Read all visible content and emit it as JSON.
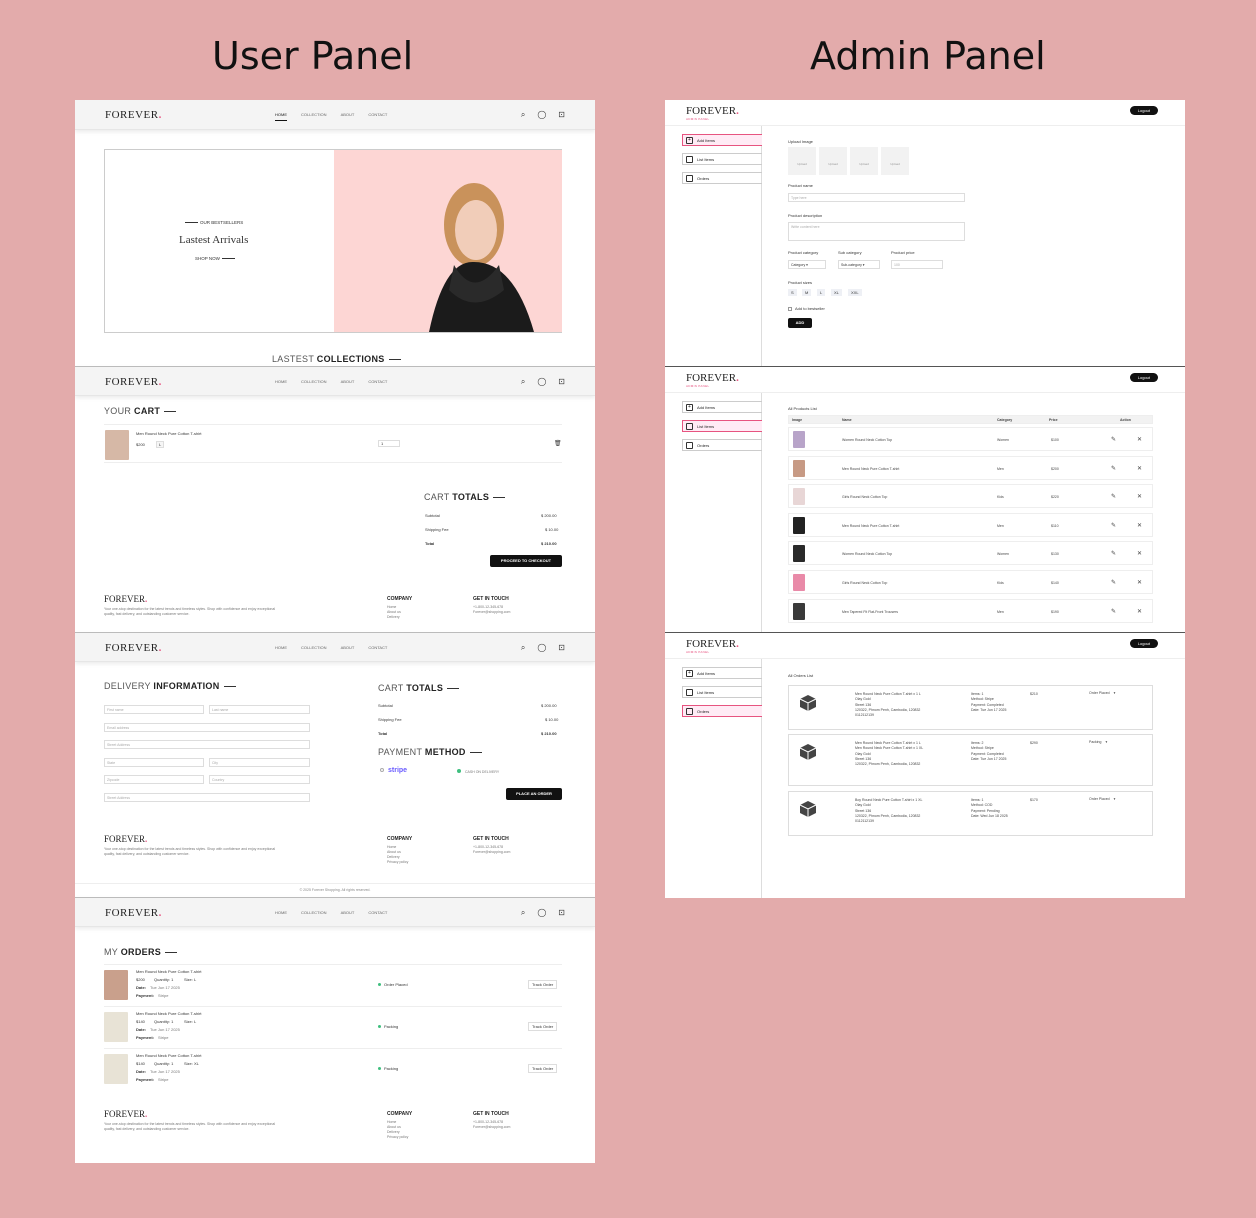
{
  "headings": {
    "user": "User Panel",
    "admin": "Admin Panel"
  },
  "brand": {
    "name": "FOREVER",
    "dot": ".",
    "admin_sub": "ADMIN PANEL",
    "accent": "#e75480"
  },
  "nav": {
    "links": [
      "HOME",
      "COLLECTION",
      "ABOUT",
      "CONTACT"
    ],
    "icons": [
      "search-icon",
      "user-icon",
      "cart-icon"
    ]
  },
  "hero": {
    "kicker": "OUR BESTSELLERS",
    "title": "Lastest Arrivals",
    "cta": "SHOP NOW",
    "collections_a": "LASTEST",
    "collections_b": "COLLECTIONS"
  },
  "cart": {
    "title_a": "YOUR",
    "title_b": "CART",
    "item": "Men Round Neck Pure Cotton T-shirt",
    "price": "$200",
    "size": "L",
    "qty": "1",
    "totals_a": "CART",
    "totals_b": "TOTALS",
    "subtotal_label": "Subtotal",
    "subtotal": "$ 200.00",
    "shipping_label": "Shipping Fee",
    "shipping": "$ 10.00",
    "total_label": "Total",
    "total": "$ 210.00",
    "checkout": "PROCEED TO CHECKOUT"
  },
  "footer": {
    "desc": "Your one-stop destination for the latest trends and timeless styles. Shop with confidence and enjoy exceptional quality, fast delivery, and outstanding customer service.",
    "company": "COMPANY",
    "company_links": [
      "Home",
      "About us",
      "Delivery",
      "Privacy policy"
    ],
    "contact": "GET IN TOUCH",
    "phone": "+1-800-12-345-678",
    "email": "Forever@shopping.com",
    "copyright": "© 2025 Forever Shopping. All rights reserved."
  },
  "delivery": {
    "title_a": "DELIVERY",
    "title_b": "INFORMATION",
    "first": "First name",
    "last": "Last name",
    "email": "Email address",
    "street": "Street Address",
    "state": "State",
    "city": "City",
    "zip": "Zipcode",
    "country": "Country",
    "phone": "Street Address",
    "payment_a": "PAYMENT",
    "payment_b": "METHOD",
    "stripe": "stripe",
    "cod": "CASH ON DELIVERY",
    "place": "PLACE AN ORDER"
  },
  "orders": {
    "title_a": "MY",
    "title_b": "ORDERS",
    "track": "Track Order",
    "items": [
      {
        "name": "Men Round Neck Pure Cotton T-shirt",
        "price": "$200",
        "qty": "Quantity: 1",
        "size": "Size: L",
        "date": "Date:",
        "date_v": "Tue Jun 17 2025",
        "pay": "Payment:",
        "pay_v": "Stripe",
        "status": "Order Placed"
      },
      {
        "name": "Men Round Neck Pure Cotton T-shirt",
        "price": "$140",
        "qty": "Quantity: 1",
        "size": "Size: L",
        "date": "Date:",
        "date_v": "Tue Jun 17 2025",
        "pay": "Payment:",
        "pay_v": "Stripe",
        "status": "Packing"
      },
      {
        "name": "Men Round Neck Pure Cotton T-shirt",
        "price": "$140",
        "qty": "Quantity: 1",
        "size": "Size: XL",
        "date": "Date:",
        "date_v": "Tue Jun 17 2025",
        "pay": "Payment:",
        "pay_v": "Stripe",
        "status": "Packing"
      }
    ]
  },
  "admin": {
    "logout": "Logout",
    "sidebar": [
      "Add Items",
      "List Items",
      "Orders"
    ],
    "add": {
      "upload": "Upload Image",
      "upload_box": "Upload",
      "name_label": "Product name",
      "name_ph": "Type here",
      "desc_label": "Product description",
      "desc_ph": "Write content here",
      "cat_label": "Product category",
      "cat": "Category",
      "sub_label": "Sub category",
      "sub": "Sub-category",
      "price_label": "Product price",
      "price_ph": "100",
      "sizes_label": "Product sizes",
      "sizes": [
        "S",
        "M",
        "L",
        "XL",
        "XXL"
      ],
      "best": "Add to bestseller",
      "add_btn": "ADD"
    },
    "list": {
      "title": "All Products List",
      "cols": [
        "Image",
        "Name",
        "Category",
        "Price",
        "Action"
      ],
      "rows": [
        {
          "name": "Women Round Neck Cotton Top",
          "cat": "Women",
          "price": "$100"
        },
        {
          "name": "Men Round Neck Pure Cotton T-shirt",
          "cat": "Men",
          "price": "$200"
        },
        {
          "name": "Girls Round Neck Cotton Top",
          "cat": "Kids",
          "price": "$220"
        },
        {
          "name": "Men Round Neck Pure Cotton T-shirt",
          "cat": "Men",
          "price": "$110"
        },
        {
          "name": "Women Round Neck Cotton Top",
          "cat": "Women",
          "price": "$130"
        },
        {
          "name": "Girls Round Neck Cotton Top",
          "cat": "Kids",
          "price": "$140"
        },
        {
          "name": "Men Tapered Fit Flat-Front Trousers",
          "cat": "Men",
          "price": "$190"
        }
      ]
    },
    "orders": {
      "title": "All Orders List",
      "rows": [
        {
          "l1": "Men Round Neck Pure Cotton T-shirt x 1 L",
          "l2": "Olay Gold",
          "l3": "Street 136",
          "l4": "120322, Phnom Penh, Cambodia, 120832",
          "l5": "0112112139",
          "items": "Items: 1",
          "method": "Method: Stripe",
          "payment": "Payment: Completed",
          "date": "Date: Tue Jun 17 2025",
          "amount": "$210",
          "status": "Order Placed"
        },
        {
          "l1": "Men Round Neck Pure Cotton T-shirt x 1 L",
          "l2": "Men Round Neck Pure Cotton T-shirt x 1 XL",
          "l3": "Olay Gold",
          "l4": "Street 136",
          "l5": "120322, Phnom Penh, Cambodia, 120832",
          "items": "Items: 2",
          "method": "Method: Stripe",
          "payment": "Payment: Completed",
          "date": "Date: Tue Jun 17 2025",
          "amount": "$290",
          "status": "Packing"
        },
        {
          "l1": "Boy Round Neck Pure Cotton T-shirt x 1 XL",
          "l2": "Olay Gold",
          "l3": "Street 136",
          "l4": "120322, Phnom Penh, Cambodia, 120832",
          "l5": "0112112139",
          "items": "Items: 1",
          "method": "Method: COD",
          "payment": "Payment: Pending",
          "date": "Date: Wed Jun 18 2025",
          "amount": "$170",
          "status": "Order Placed"
        }
      ]
    }
  }
}
